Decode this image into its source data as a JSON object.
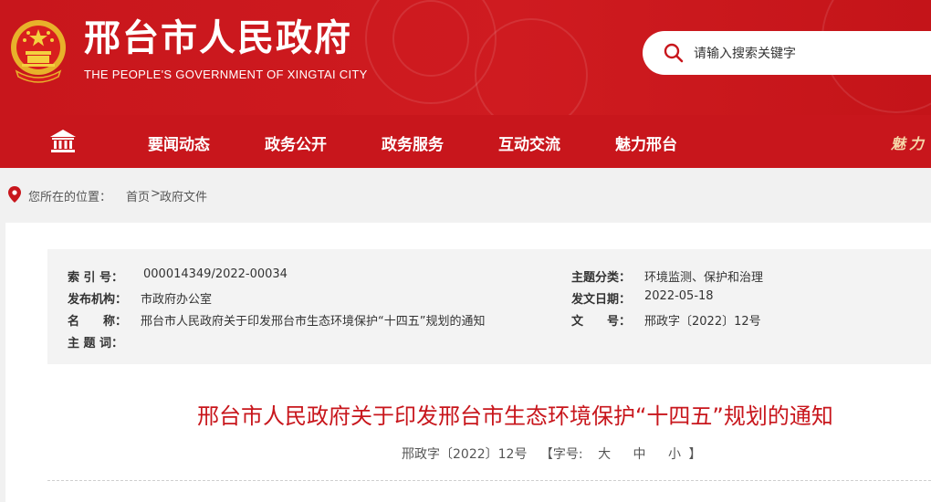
{
  "header": {
    "title": "邢台市人民政府",
    "subtitle": "THE PEOPLE'S GOVERNMENT OF XINGTAI CITY",
    "brand_color": "#c8161c",
    "search": {
      "placeholder": "请输入搜索关键字",
      "icon": "search-icon"
    }
  },
  "nav": {
    "home_icon": "government-building-icon",
    "items": [
      {
        "label": "要闻动态"
      },
      {
        "label": "政务公开"
      },
      {
        "label": "政务服务"
      },
      {
        "label": "互动交流"
      },
      {
        "label": "魅力邢台"
      }
    ],
    "slogan": "魅力"
  },
  "breadcrumb": {
    "icon": "location-pin-icon",
    "label": "您所在的位置：",
    "home": "首页",
    "separator": ">",
    "current": "政府文件"
  },
  "meta": {
    "index_label": "索 引 号：",
    "index_value": "000014349/2022-00034",
    "publisher_label": "发布机构：",
    "publisher_value": "市政府办公室",
    "name_label": "名　　称：",
    "name_value": "邢台市人民政府关于印发邢台市生态环境保护“十四五”规划的通知",
    "topic_label": "主 题 词：",
    "topic_value": "",
    "category_label": "主题分类：",
    "category_value": "环境监测、保护和治理",
    "date_label": "发文日期：",
    "date_value": "2022-05-18",
    "docno_label": "文　　号：",
    "docno_value": "邢政字〔2022〕12号"
  },
  "document": {
    "title": "邢台市人民政府关于印发邢台市生态环境保护“十四五”规划的通知",
    "doc_number": "邢政字〔2022〕12号",
    "font_size_prefix": "【字号:",
    "size_large": "大",
    "size_medium": "中",
    "size_small": "小",
    "font_size_suffix": "】"
  }
}
